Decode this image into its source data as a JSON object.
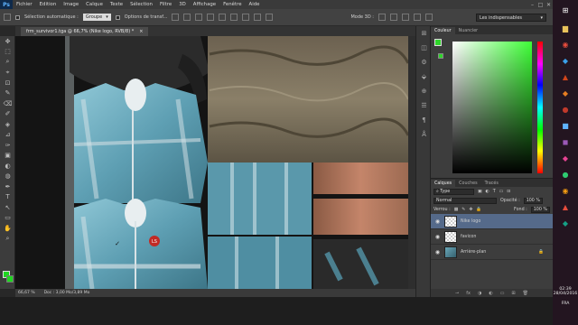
{
  "app": {
    "logo": "Ps"
  },
  "menu": {
    "items": [
      "Fichier",
      "Edition",
      "Image",
      "Calque",
      "Texte",
      "Sélection",
      "Filtre",
      "3D",
      "Affichage",
      "Fenêtre",
      "Aide"
    ]
  },
  "window_controls": {
    "minimize": "–",
    "maximize": "□",
    "close": "✕"
  },
  "options": {
    "auto_select_label": "Sélection automatique :",
    "group_value": "Groupe",
    "transform_label": "Options de transf...",
    "mode3d_label": "Mode 3D :",
    "workspace": "Les indispensables"
  },
  "document": {
    "tab_title": "frm_survivor1.tga @ 66,7% (Nike logo, RVB/8) *",
    "tab_close": "×",
    "zoom": "66,67 %",
    "doc_info": "Doc : 3,00 Mo/3,89 Mo"
  },
  "texture_labels": {
    "badge": "LS",
    "logo": "✓"
  },
  "tools": [
    "✥",
    "⬚",
    "⌕",
    "⌖",
    "⊡",
    "✎",
    "⌫",
    "✐",
    "◈",
    "⊿",
    "✑",
    "▣",
    "◐",
    "◍",
    "✒",
    "T",
    "↖",
    "▭",
    "✋",
    "⌕"
  ],
  "panel_icons": [
    "⊞",
    "◫",
    "⚙",
    "⬙",
    "⊕",
    "☰",
    "¶",
    "Å"
  ],
  "color_panel": {
    "tabs": [
      "Couleur",
      "Nuancier"
    ]
  },
  "layers_panel": {
    "tabs": [
      "Calques",
      "Couches",
      "Tracés"
    ],
    "filter_label": "Type",
    "blend_mode": "Normal",
    "opacity_label": "Opacité :",
    "opacity_value": "100 %",
    "lock_label": "Verrou :",
    "fill_label": "Fond :",
    "fill_value": "100 %",
    "layers": [
      {
        "name": "Nike logo",
        "selected": true,
        "thumb": "checker"
      },
      {
        "name": "favicon",
        "selected": false,
        "thumb": "checker"
      },
      {
        "name": "Arrière-plan",
        "selected": false,
        "thumb": "photo"
      }
    ],
    "bottom_icons": [
      "⊸",
      "fx",
      "◑",
      "◐",
      "▭",
      "⊞",
      "🗑"
    ]
  },
  "taskbar": {
    "time": "02:39",
    "date": "28/04/2016",
    "lang": "FRA"
  },
  "colors": {
    "foreground": "#1fd620",
    "background": "#1fd620",
    "accent": "#556a8a"
  }
}
